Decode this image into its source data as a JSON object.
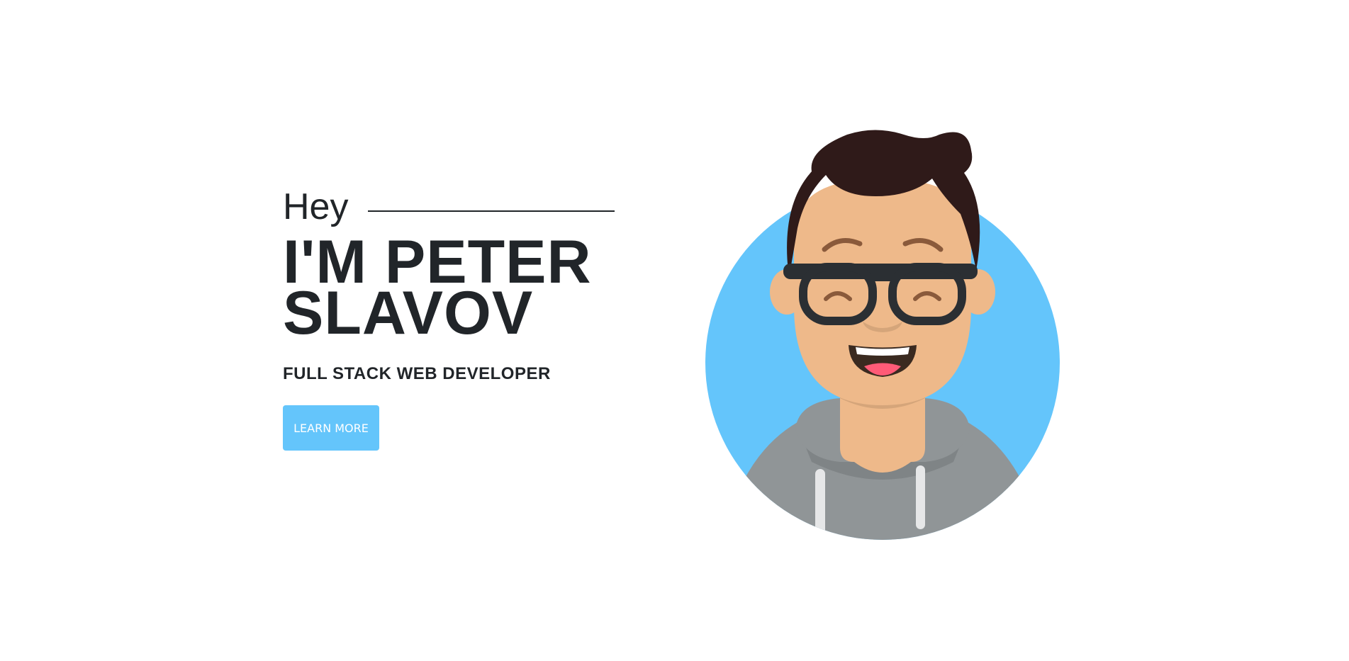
{
  "hero": {
    "greeting": "Hey",
    "name_line1": "I'M PETER",
    "name_line2": "SLAVOV",
    "role": "FULL STACK WEB DEVELOPER",
    "cta_label": "LEARN MORE"
  },
  "avatar": {
    "icon": "developer-avatar-illustration"
  },
  "colors": {
    "accent": "#64c5fb",
    "text": "#212529",
    "skin": "#eeb98a",
    "hair": "#2f1a19",
    "hoodie": "#909597",
    "glasses": "#2b2f33"
  }
}
